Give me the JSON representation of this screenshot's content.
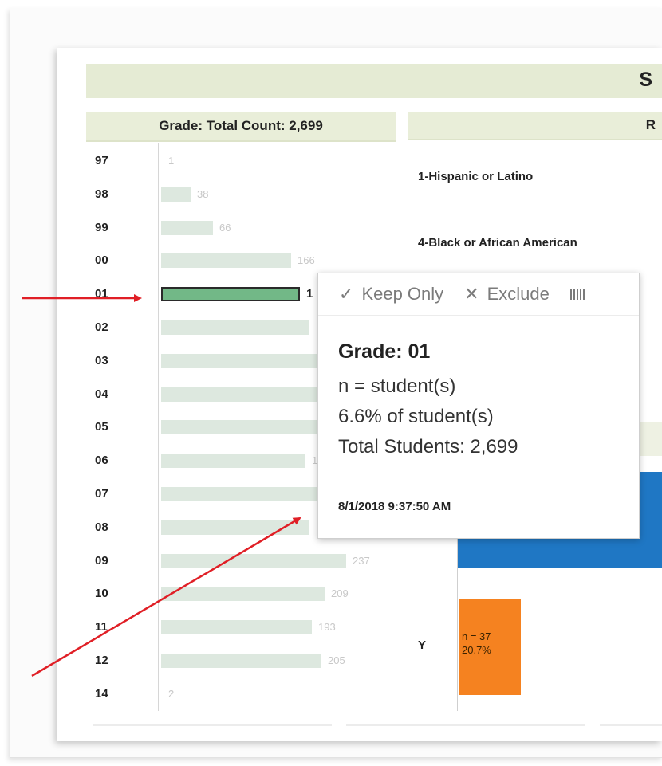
{
  "header": {
    "title_fragment": "S"
  },
  "grade_panel": {
    "header": "Grade: Total Count: 2,699",
    "rows": [
      {
        "grade": "97",
        "count": 1,
        "label": "1"
      },
      {
        "grade": "98",
        "count": 38,
        "label": "38"
      },
      {
        "grade": "99",
        "count": 66,
        "label": "66"
      },
      {
        "grade": "00",
        "count": 166,
        "label": "166"
      },
      {
        "grade": "01",
        "count": 178,
        "label": "1",
        "selected": true
      },
      {
        "grade": "02",
        "count": 190,
        "label": ""
      },
      {
        "grade": "03",
        "count": 205,
        "label": ""
      },
      {
        "grade": "04",
        "count": 200,
        "label": ""
      },
      {
        "grade": "05",
        "count": 210,
        "label": ""
      },
      {
        "grade": "06",
        "count": 185,
        "label": "1"
      },
      {
        "grade": "07",
        "count": 200,
        "label": ""
      },
      {
        "grade": "08",
        "count": 190,
        "label": ""
      },
      {
        "grade": "09",
        "count": 237,
        "label": "237"
      },
      {
        "grade": "10",
        "count": 209,
        "label": "209"
      },
      {
        "grade": "11",
        "count": 193,
        "label": "193"
      },
      {
        "grade": "12",
        "count": 205,
        "label": "205"
      },
      {
        "grade": "14",
        "count": 2,
        "label": "2"
      }
    ]
  },
  "race_panel": {
    "header": "R",
    "items": [
      "1-Hispanic or Latino",
      "4-Black or African American"
    ],
    "y_label": "Y",
    "orange_bar": {
      "n_label": "n = 37",
      "pct_label": "20.7%"
    },
    "colors": {
      "blue": "#1f77c4",
      "orange": "#f58220"
    }
  },
  "tooltip": {
    "keep_only": "Keep Only",
    "exclude": "Exclude",
    "title": "Grade: 01",
    "n_line": "n =  student(s)",
    "pct_line": "6.6% of student(s)",
    "total_line": "Total Students: 2,699",
    "timestamp": "8/1/2018 9:37:50 AM"
  },
  "colors": {
    "arrow": "#e01f26",
    "bar": "#dde8df",
    "selected_bar": "#72b887",
    "banner": "#e5ebd4"
  }
}
